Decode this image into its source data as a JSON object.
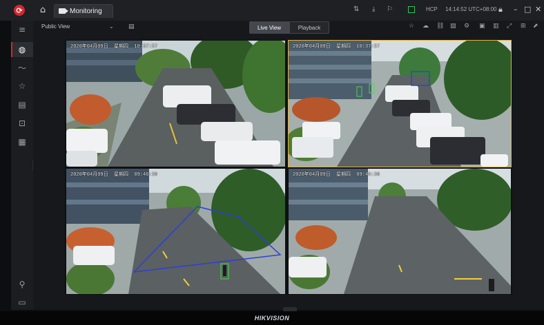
{
  "app": {
    "tab_label": "Monitoring",
    "status_hcp": "HCP",
    "status_time": "14:14:52 UTC+08:00",
    "brand": "HIKVISION",
    "accent": "#d7262f"
  },
  "toolbar": {
    "view_label": "Public View",
    "live_view_label": "Live View",
    "playback_label": "Playback"
  },
  "sidebar": {
    "items": [
      "menu-icon",
      "globe-icon",
      "pulse-icon",
      "star-icon",
      "list-icon",
      "person-icon",
      "grid-icon",
      "user-icon",
      "folder-icon"
    ]
  },
  "cameras": [
    {
      "timestamp": "2020年04月09日  星期四  10:37:57"
    },
    {
      "timestamp": "2020年04月09日  星期四  10:37:57"
    },
    {
      "timestamp": "2020年04月09日  星期四  09:46:30"
    },
    {
      "timestamp": "2020年04月09日  星期四  09:46:30"
    }
  ]
}
